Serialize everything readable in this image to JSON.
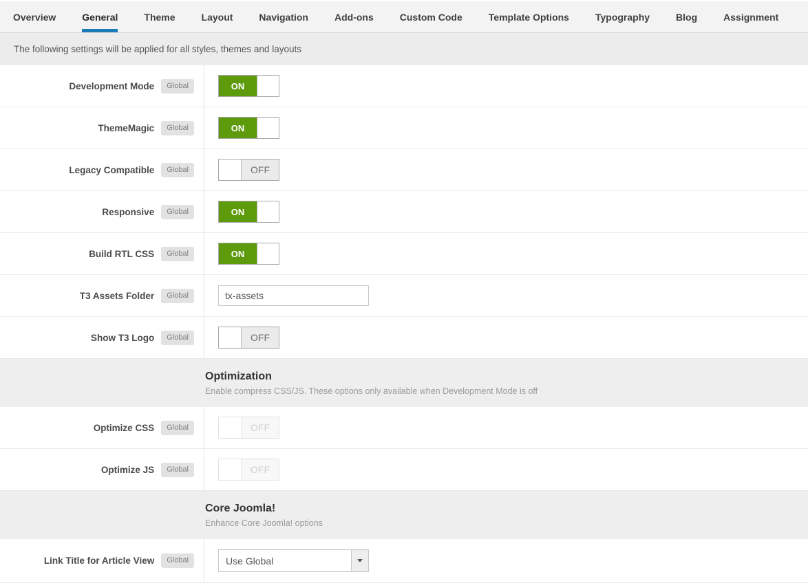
{
  "tabs": [
    {
      "label": "Overview",
      "active": false
    },
    {
      "label": "General",
      "active": true
    },
    {
      "label": "Theme",
      "active": false
    },
    {
      "label": "Layout",
      "active": false
    },
    {
      "label": "Navigation",
      "active": false
    },
    {
      "label": "Add-ons",
      "active": false
    },
    {
      "label": "Custom Code",
      "active": false
    },
    {
      "label": "Template Options",
      "active": false
    },
    {
      "label": "Typography",
      "active": false
    },
    {
      "label": "Blog",
      "active": false
    },
    {
      "label": "Assignment",
      "active": false
    }
  ],
  "notice": {
    "text": "The following settings will be applied for all styles, themes and layouts"
  },
  "toggle": {
    "on_label": "ON",
    "off_label": "OFF"
  },
  "rows": [
    {
      "type": "toggle",
      "label": "Development Mode",
      "badge": "Global",
      "state": "on"
    },
    {
      "type": "toggle",
      "label": "ThemeMagic",
      "badge": "Global",
      "state": "on"
    },
    {
      "type": "toggle",
      "label": "Legacy Compatible",
      "badge": "Global",
      "state": "off"
    },
    {
      "type": "toggle",
      "label": "Responsive",
      "badge": "Global",
      "state": "on"
    },
    {
      "type": "toggle",
      "label": "Build RTL CSS",
      "badge": "Global",
      "state": "on"
    },
    {
      "type": "text",
      "label": "T3 Assets Folder",
      "badge": "Global",
      "value": "tx-assets"
    },
    {
      "type": "toggle",
      "label": "Show T3 Logo",
      "badge": "Global",
      "state": "off"
    },
    {
      "type": "section",
      "title": "Optimization",
      "desc": "Enable compress CSS/JS. These options only available when Development Mode is off"
    },
    {
      "type": "toggle",
      "label": "Optimize CSS",
      "badge": "Global",
      "state": "off",
      "disabled": true
    },
    {
      "type": "toggle",
      "label": "Optimize JS",
      "badge": "Global",
      "state": "off",
      "disabled": true
    },
    {
      "type": "section",
      "title": "Core Joomla!",
      "desc": "Enhance Core Joomla! options"
    },
    {
      "type": "select",
      "label": "Link Title for Article View",
      "badge": "Global",
      "value": "Use Global"
    }
  ],
  "colors": {
    "accent_blue": "#1a7ab8",
    "toggle_on_green": "#5e9b0c",
    "section_bg": "#eeeeee",
    "notice_bg": "#ececec"
  }
}
